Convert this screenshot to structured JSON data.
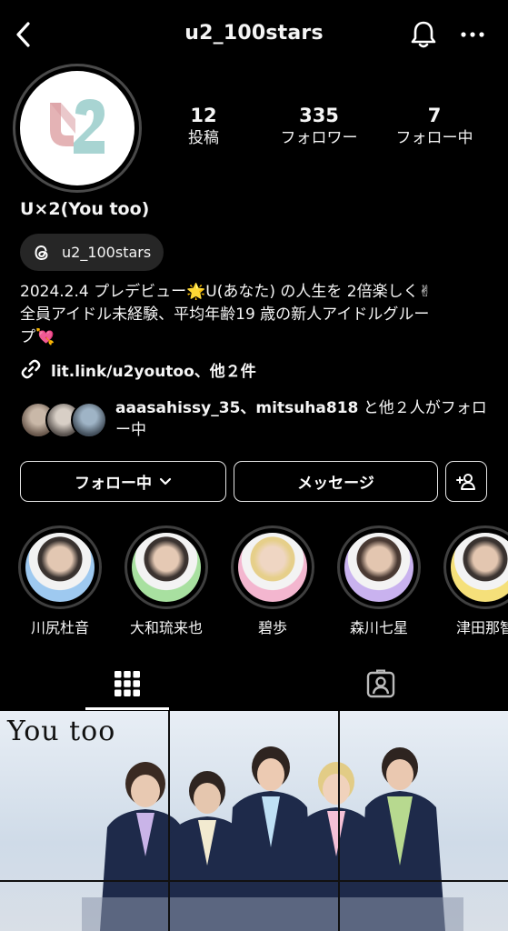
{
  "header": {
    "username": "u2_100stars",
    "back_icon": "chevron-left-icon",
    "bell_icon": "bell-icon",
    "more_icon": "more-horizontal-icon"
  },
  "profile": {
    "display_name": "U×2(You too)",
    "stats": [
      {
        "value": "12",
        "label": "投稿"
      },
      {
        "value": "335",
        "label": "フォロワー"
      },
      {
        "value": "7",
        "label": "フォロー中"
      }
    ],
    "threads_handle": "u2_100stars",
    "bio_lines": [
      "2024.2.4 プレデビュー🌟U(あなた) の人生を 2倍楽しく✌",
      "全員アイドル未経験、平均年齢19 歳の新人アイドルグルー",
      "プ💘"
    ],
    "link_text": "lit.link/u2youtoo、他２件",
    "followed_by": {
      "users": "aaasahissy_35、mitsuha818",
      "rest": " と他２人がフォロー中"
    }
  },
  "actions": {
    "follow_label": "フォロー中",
    "message_label": "メッセージ"
  },
  "highlights": [
    {
      "label": "川尻杜音",
      "color": "#9ec9f0"
    },
    {
      "label": "大和琉来也",
      "color": "#a8e0a0"
    },
    {
      "label": "碧歩",
      "color": "#f3b6cf"
    },
    {
      "label": "森川七星",
      "color": "#c9b2ef"
    },
    {
      "label": "津田那智",
      "color": "#f5e07a"
    }
  ],
  "post": {
    "caption": "You too"
  },
  "colors": {
    "background": "#000000",
    "pill": "#262626",
    "threads_bg": "#262626"
  }
}
